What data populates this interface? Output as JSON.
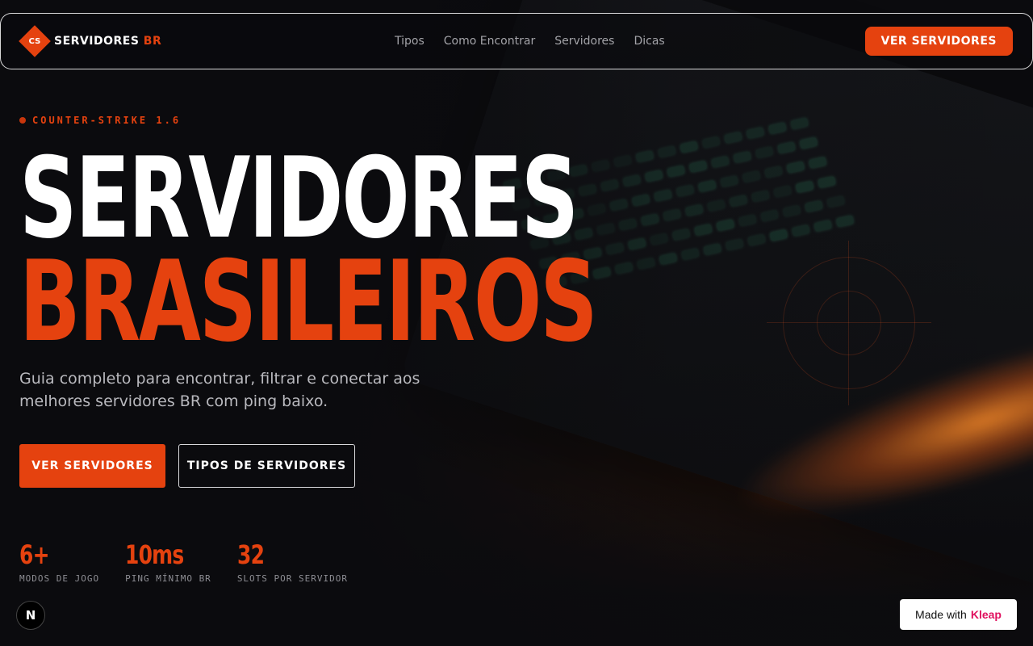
{
  "nav": {
    "logo_mark": "CS",
    "logo_text": "SERVIDORES",
    "logo_accent": "BR",
    "links": [
      "Tipos",
      "Como Encontrar",
      "Servidores",
      "Dicas"
    ],
    "cta_label": "VER SERVIDORES"
  },
  "hero": {
    "eyebrow": "COUNTER-STRIKE 1.6",
    "title_line1": "SERVIDORES",
    "title_line2": "BRASILEIROS",
    "subtitle": "Guia completo para encontrar, filtrar e conectar aos melhores servidores BR com ping baixo.",
    "primary_button": "VER SERVIDORES",
    "secondary_button": "TIPOS DE SERVIDORES"
  },
  "stats": [
    {
      "value": "6+",
      "label": "MODOS DE JOGO"
    },
    {
      "value": "10ms",
      "label": "PING MÍNIMO BR"
    },
    {
      "value": "32",
      "label": "SLOTS POR SERVIDOR"
    }
  ],
  "badge": {
    "letter": "N"
  },
  "kleap": {
    "prefix": "Made with",
    "brand": "Kleap"
  },
  "colors": {
    "accent": "#e5420f",
    "background": "#0b0b0e"
  }
}
